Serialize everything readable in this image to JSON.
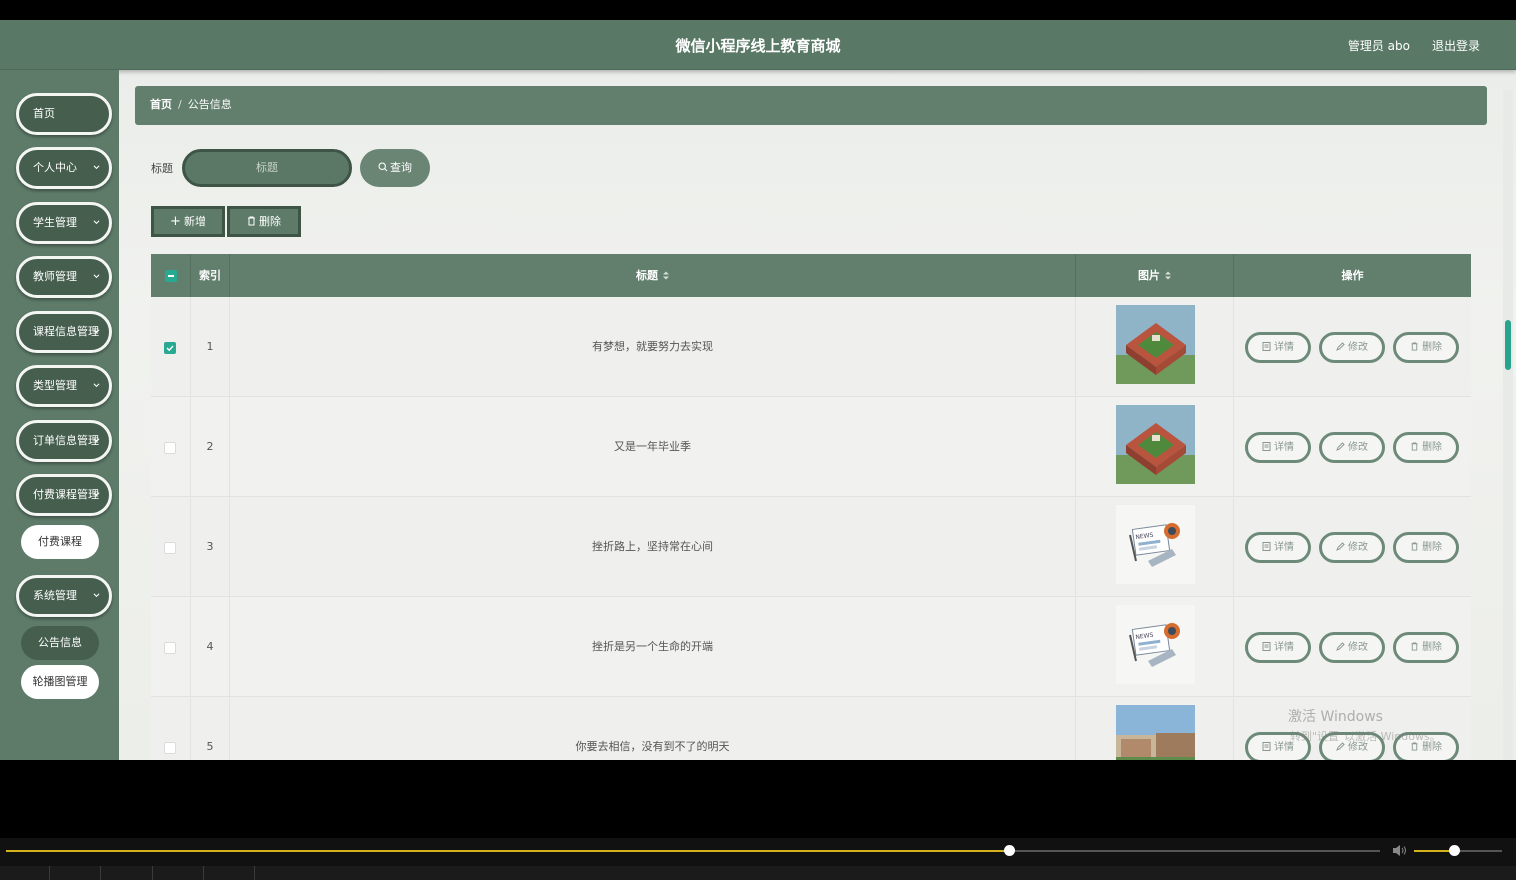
{
  "header": {
    "title": "微信小程序线上教育商城",
    "user": "管理员 abo",
    "logout": "退出登录"
  },
  "sidebar": {
    "items": [
      {
        "label": "首页",
        "expandable": false
      },
      {
        "label": "个人中心",
        "expandable": true
      },
      {
        "label": "学生管理",
        "expandable": true
      },
      {
        "label": "教师管理",
        "expandable": true
      },
      {
        "label": "课程信息管理",
        "expandable": true
      },
      {
        "label": "类型管理",
        "expandable": true
      },
      {
        "label": "订单信息管理",
        "expandable": true
      },
      {
        "label": "付费课程管理",
        "expandable": true
      },
      {
        "label": "系统管理",
        "expandable": true
      }
    ],
    "sub_paid": "付费课程",
    "sub_system": [
      "公告信息",
      "轮播图管理"
    ]
  },
  "breadcrumb": {
    "home": "首页",
    "separator": "/",
    "current": "公告信息"
  },
  "search": {
    "label": "标题",
    "placeholder": "标题",
    "button": "查询"
  },
  "actions": {
    "add": "新增",
    "delete": "删除"
  },
  "table": {
    "columns": [
      "索引",
      "标题",
      "图片",
      "操作"
    ],
    "rows": [
      {
        "index": "1",
        "title": "有梦想，就要努力去实现",
        "image": "building",
        "checked": true
      },
      {
        "index": "2",
        "title": "又是一年毕业季",
        "image": "building",
        "checked": false
      },
      {
        "index": "3",
        "title": "挫折路上，坚持常在心间",
        "image": "news",
        "checked": false
      },
      {
        "index": "4",
        "title": "挫折是另一个生命的开端",
        "image": "news",
        "checked": false
      },
      {
        "index": "5",
        "title": "你要去相信，没有到不了的明天",
        "image": "campus",
        "checked": false
      }
    ],
    "op_labels": [
      "详情",
      "修改",
      "删除"
    ]
  },
  "player": {
    "progress": 0.73,
    "volume": 0.45
  },
  "watermark": {
    "line1": "激活 Windows",
    "line2": "转到\"设置\"以激活 Windows。"
  },
  "colors": {
    "primary": "#5a7866",
    "dark": "#455e4e",
    "accent": "#27a992"
  }
}
